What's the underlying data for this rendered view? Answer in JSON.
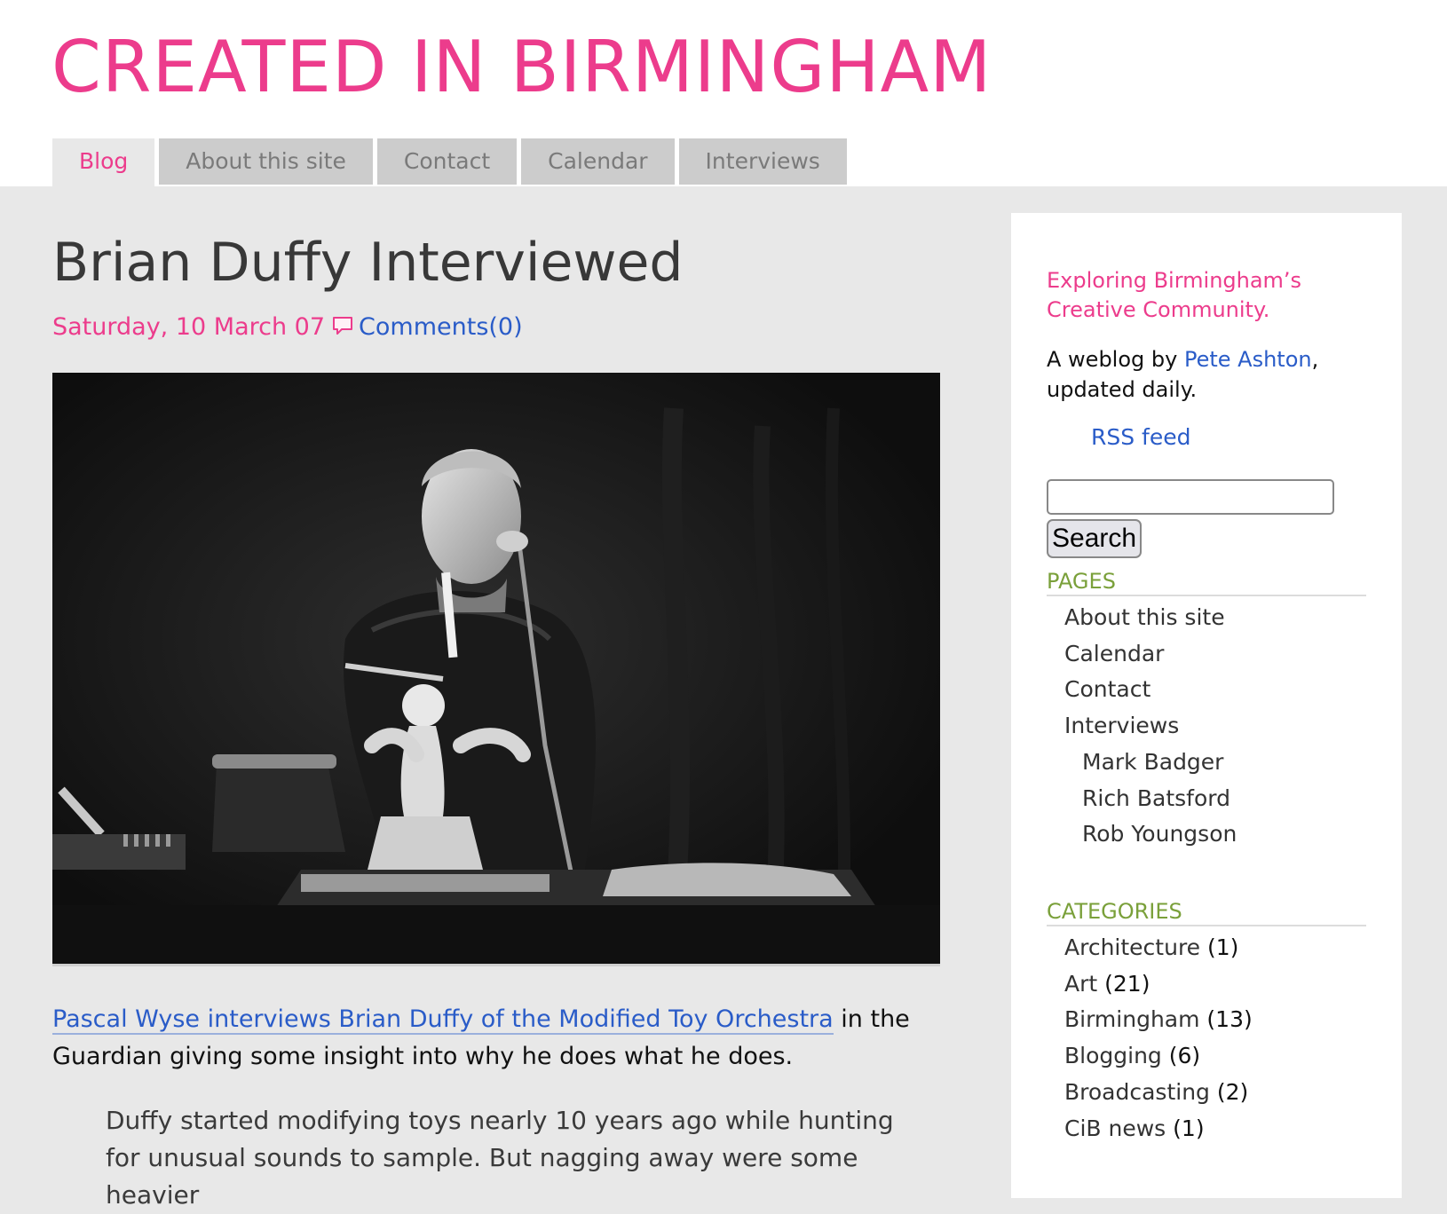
{
  "site": {
    "title": "CREATED IN BIRMINGHAM"
  },
  "nav": {
    "tabs": [
      {
        "label": "Blog",
        "active": true
      },
      {
        "label": "About this site"
      },
      {
        "label": "Contact"
      },
      {
        "label": "Calendar"
      },
      {
        "label": "Interviews"
      }
    ]
  },
  "post": {
    "title": "Brian Duffy Interviewed",
    "date": "Saturday, 10 March 07",
    "comments_label": "Comments(0)",
    "link_text": "Pascal Wyse interviews Brian Duffy of the Modified Toy Orchestra",
    "body_rest": " in the Guardian giving some insight into why he does what he does.",
    "quote": "Duffy started modifying toys nearly 10 years ago while hunting for unusual sounds to sample. But nagging away were some heavier"
  },
  "sidebar": {
    "tagline": "Exploring Birmingham’s Creative Community.",
    "byline_prefix": "A weblog by ",
    "author": "Pete Ashton",
    "byline_suffix": ", updated daily.",
    "rss_label": "RSS feed",
    "search_value": "",
    "search_button": "Search",
    "pages_heading": "PAGES",
    "pages": [
      "About this site",
      "Calendar",
      "Contact",
      "Interviews"
    ],
    "interview_subpages": [
      "Mark Badger",
      "Rich Batsford",
      "Rob Youngson"
    ],
    "categories_heading": "CATEGORIES",
    "categories": [
      {
        "name": "Architecture",
        "count": "(1)"
      },
      {
        "name": "Art",
        "count": "(21)"
      },
      {
        "name": "Birmingham",
        "count": "(13)"
      },
      {
        "name": "Blogging",
        "count": "(6)"
      },
      {
        "name": "Broadcasting",
        "count": "(2)"
      },
      {
        "name": "CiB news",
        "count": "(1)"
      }
    ]
  },
  "colors": {
    "accent": "#ec3c8c",
    "link": "#2a5cc8",
    "sidebar_heading": "#7aa03a",
    "tab_bg": "#cccccc",
    "page_bg": "#e8e8e8"
  }
}
